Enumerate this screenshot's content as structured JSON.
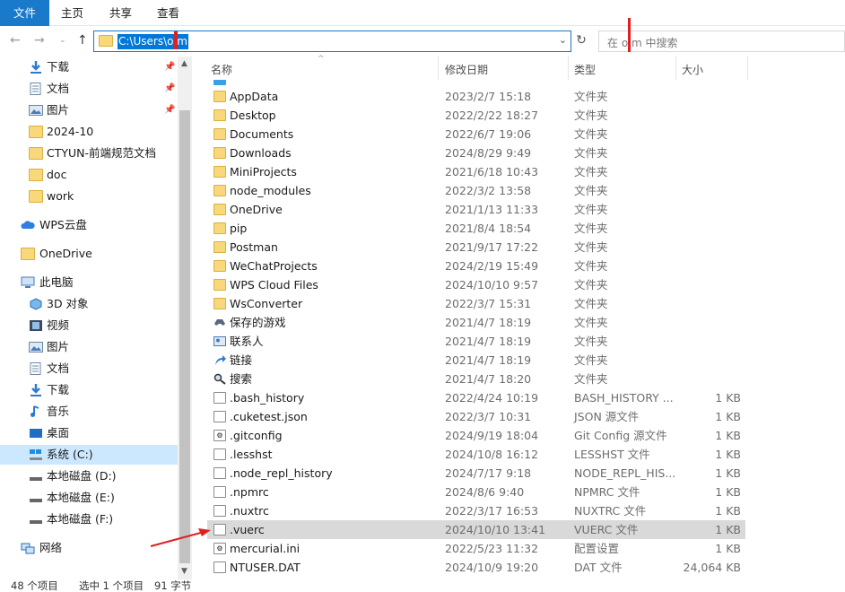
{
  "ribbon": {
    "tabs": [
      {
        "label": "文件"
      },
      {
        "label": "主页"
      },
      {
        "label": "共享"
      },
      {
        "label": "查看"
      }
    ]
  },
  "address": {
    "path": "C:\\Users\\o m",
    "search_placeholder": "在 o m 中搜索"
  },
  "sidebar": {
    "items": [
      {
        "label": "下载",
        "icon": "download-arrow-icon",
        "pinned": true
      },
      {
        "label": "文档",
        "icon": "document-icon",
        "pinned": true
      },
      {
        "label": "图片",
        "icon": "picture-icon",
        "pinned": true
      },
      {
        "label": "2024-10",
        "icon": "folder-icon"
      },
      {
        "label": "CTYUN-前端规范文档",
        "icon": "folder-icon"
      },
      {
        "label": "doc",
        "icon": "folder-icon"
      },
      {
        "label": "work",
        "icon": "folder-icon"
      },
      {
        "label": "WPS云盘",
        "icon": "cloud-icon"
      },
      {
        "label": "OneDrive",
        "icon": "folder-icon"
      },
      {
        "label": "此电脑",
        "icon": "computer-icon"
      },
      {
        "label": "3D 对象",
        "icon": "3d-objects-icon"
      },
      {
        "label": "视频",
        "icon": "video-icon"
      },
      {
        "label": "图片",
        "icon": "picture-icon"
      },
      {
        "label": "文档",
        "icon": "document-icon"
      },
      {
        "label": "下载",
        "icon": "download-arrow-icon"
      },
      {
        "label": "音乐",
        "icon": "music-icon"
      },
      {
        "label": "桌面",
        "icon": "desktop-icon"
      },
      {
        "label": "系统 (C:)",
        "icon": "drive-c-icon",
        "selected": true
      },
      {
        "label": "本地磁盘 (D:)",
        "icon": "drive-icon"
      },
      {
        "label": "本地磁盘 (E:)",
        "icon": "drive-icon"
      },
      {
        "label": "本地磁盘 (F:)",
        "icon": "drive-icon"
      },
      {
        "label": "网络",
        "icon": "network-icon"
      }
    ]
  },
  "columns": {
    "name": "名称",
    "date": "修改日期",
    "type": "类型",
    "size": "大小"
  },
  "files": [
    {
      "name": "AppData",
      "date": "2023/2/7 15:18",
      "type": "文件夹",
      "size": "",
      "kind": "folder"
    },
    {
      "name": "Desktop",
      "date": "2022/2/22 18:27",
      "type": "文件夹",
      "size": "",
      "kind": "folder"
    },
    {
      "name": "Documents",
      "date": "2022/6/7 19:06",
      "type": "文件夹",
      "size": "",
      "kind": "folder"
    },
    {
      "name": "Downloads",
      "date": "2024/8/29 9:49",
      "type": "文件夹",
      "size": "",
      "kind": "folder"
    },
    {
      "name": "MiniProjects",
      "date": "2021/6/18 10:43",
      "type": "文件夹",
      "size": "",
      "kind": "folder"
    },
    {
      "name": "node_modules",
      "date": "2022/3/2 13:58",
      "type": "文件夹",
      "size": "",
      "kind": "folder"
    },
    {
      "name": "OneDrive",
      "date": "2021/1/13 11:33",
      "type": "文件夹",
      "size": "",
      "kind": "folder"
    },
    {
      "name": "pip",
      "date": "2021/8/4 18:54",
      "type": "文件夹",
      "size": "",
      "kind": "folder"
    },
    {
      "name": "Postman",
      "date": "2021/9/17 17:22",
      "type": "文件夹",
      "size": "",
      "kind": "folder"
    },
    {
      "name": "WeChatProjects",
      "date": "2024/2/19 15:49",
      "type": "文件夹",
      "size": "",
      "kind": "folder"
    },
    {
      "name": "WPS Cloud Files",
      "date": "2024/10/10 9:57",
      "type": "文件夹",
      "size": "",
      "kind": "folder"
    },
    {
      "name": "WsConverter",
      "date": "2022/3/7 15:31",
      "type": "文件夹",
      "size": "",
      "kind": "folder"
    },
    {
      "name": "保存的游戏",
      "date": "2021/4/7 18:19",
      "type": "文件夹",
      "size": "",
      "kind": "games"
    },
    {
      "name": "联系人",
      "date": "2021/4/7 18:19",
      "type": "文件夹",
      "size": "",
      "kind": "contacts"
    },
    {
      "name": "链接",
      "date": "2021/4/7 18:19",
      "type": "文件夹",
      "size": "",
      "kind": "links"
    },
    {
      "name": "搜索",
      "date": "2021/4/7 18:20",
      "type": "文件夹",
      "size": "",
      "kind": "search"
    },
    {
      "name": ".bash_history",
      "date": "2022/4/24 10:19",
      "type": "BASH_HISTORY ...",
      "size": "1 KB",
      "kind": "file"
    },
    {
      "name": ".cuketest.json",
      "date": "2022/3/7 10:31",
      "type": "JSON 源文件",
      "size": "1 KB",
      "kind": "file"
    },
    {
      "name": ".gitconfig",
      "date": "2024/9/19 18:04",
      "type": "Git Config 源文件",
      "size": "1 KB",
      "kind": "gear-file"
    },
    {
      "name": ".lesshst",
      "date": "2024/10/8 16:12",
      "type": "LESSHST 文件",
      "size": "1 KB",
      "kind": "file"
    },
    {
      "name": ".node_repl_history",
      "date": "2024/7/17 9:18",
      "type": "NODE_REPL_HIS...",
      "size": "1 KB",
      "kind": "file"
    },
    {
      "name": ".npmrc",
      "date": "2024/8/6 9:40",
      "type": "NPMRC 文件",
      "size": "1 KB",
      "kind": "file"
    },
    {
      "name": ".nuxtrc",
      "date": "2022/3/17 16:53",
      "type": "NUXTRC 文件",
      "size": "1 KB",
      "kind": "file"
    },
    {
      "name": ".vuerc",
      "date": "2024/10/10 13:41",
      "type": "VUERC 文件",
      "size": "1 KB",
      "kind": "file",
      "selected": true
    },
    {
      "name": "mercurial.ini",
      "date": "2022/5/23 11:32",
      "type": "配置设置",
      "size": "1 KB",
      "kind": "ini"
    },
    {
      "name": "NTUSER.DAT",
      "date": "2024/10/9 19:20",
      "type": "DAT 文件",
      "size": "24,064 KB",
      "kind": "file"
    }
  ],
  "status": {
    "count": "48 个项目",
    "selected": "选中 1 个项目",
    "size": "91 字节"
  }
}
